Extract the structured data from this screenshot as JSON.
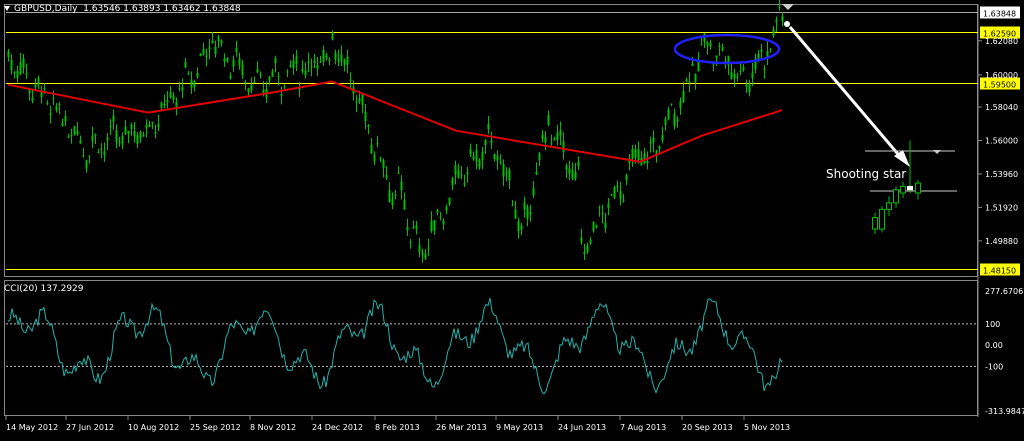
{
  "header": {
    "symbol": "GBPUSD,Daily",
    "ohlc": "1.63546 1.63893 1.63462 1.63848"
  },
  "indicator": {
    "label": "CCI(20) 137.2929"
  },
  "annotation": {
    "text": "Shooting star"
  },
  "price_axis": {
    "ticks": [
      "1.62080",
      "1.60000",
      "1.58040",
      "1.56000",
      "1.53960",
      "1.51920",
      "1.49880"
    ],
    "levels": [
      {
        "label": "1.63848",
        "value": 1.63848,
        "style": "current"
      },
      {
        "label": "1.62590",
        "value": 1.6259,
        "style": "yellow"
      },
      {
        "label": "1.59500",
        "value": 1.595,
        "style": "yellow"
      },
      {
        "label": "1.48150",
        "value": 1.4815,
        "style": "yellow"
      }
    ]
  },
  "cci_axis": {
    "ticks": [
      "277.6706",
      "100",
      "0.00",
      "-100",
      "-313.9847"
    ]
  },
  "time_axis": {
    "labels": [
      "14 May 2012",
      "27 Jun 2012",
      "10 Aug 2012",
      "25 Sep 2012",
      "8 Nov 2012",
      "24 Dec 2012",
      "8 Feb 2013",
      "26 Mar 2013",
      "9 May 2013",
      "24 Jun 2013",
      "7 Aug 2013",
      "20 Sep 2013",
      "5 Nov 2013"
    ]
  },
  "colors": {
    "candles": "#00c000",
    "ma": "#e00000",
    "yellow_line": "#ffff00",
    "cci": "#20b2aa",
    "ellipse": "#2020ff",
    "arrow": "#ffffff"
  },
  "chart_data": {
    "type": "candlestick",
    "price_series_anchors": [
      {
        "date": "14 May 2012",
        "value": 1.612
      },
      {
        "date": "27 Jun 2012",
        "value": 1.556
      },
      {
        "date": "10 Aug 2012",
        "value": 1.568
      },
      {
        "date": "25 Sep 2012",
        "value": 1.622
      },
      {
        "date": "8 Nov 2012",
        "value": 1.598
      },
      {
        "date": "24 Dec 2012",
        "value": 1.626
      },
      {
        "date": "8 Feb 2013",
        "value": 1.525
      },
      {
        "date": "26 Mar 2013",
        "value": 1.535
      },
      {
        "date": "9 May 2013",
        "value": 1.522
      },
      {
        "date": "24 Jun 2013",
        "value": 1.535
      },
      {
        "date": "7 Aug 2013",
        "value": 1.552
      },
      {
        "date": "20 Sep 2013",
        "value": 1.622
      },
      {
        "date": "5 Nov 2013",
        "value": 1.612
      }
    ],
    "moving_average_anchors": [
      {
        "date": "14 May 2012",
        "value": 1.594
      },
      {
        "date": "10 Aug 2012",
        "value": 1.577
      },
      {
        "date": "8 Nov 2012",
        "value": 1.589
      },
      {
        "date": "24 Dec 2012",
        "value": 1.596
      },
      {
        "date": "26 Mar 2013",
        "value": 1.566
      },
      {
        "date": "7 Aug 2013",
        "value": 1.547
      },
      {
        "date": "20 Sep 2013",
        "value": 1.563
      }
    ],
    "cci_range": [
      -313.9847,
      277.6706
    ],
    "cci_levels": [
      100,
      -100
    ],
    "price_range": [
      1.478,
      1.642
    ]
  }
}
